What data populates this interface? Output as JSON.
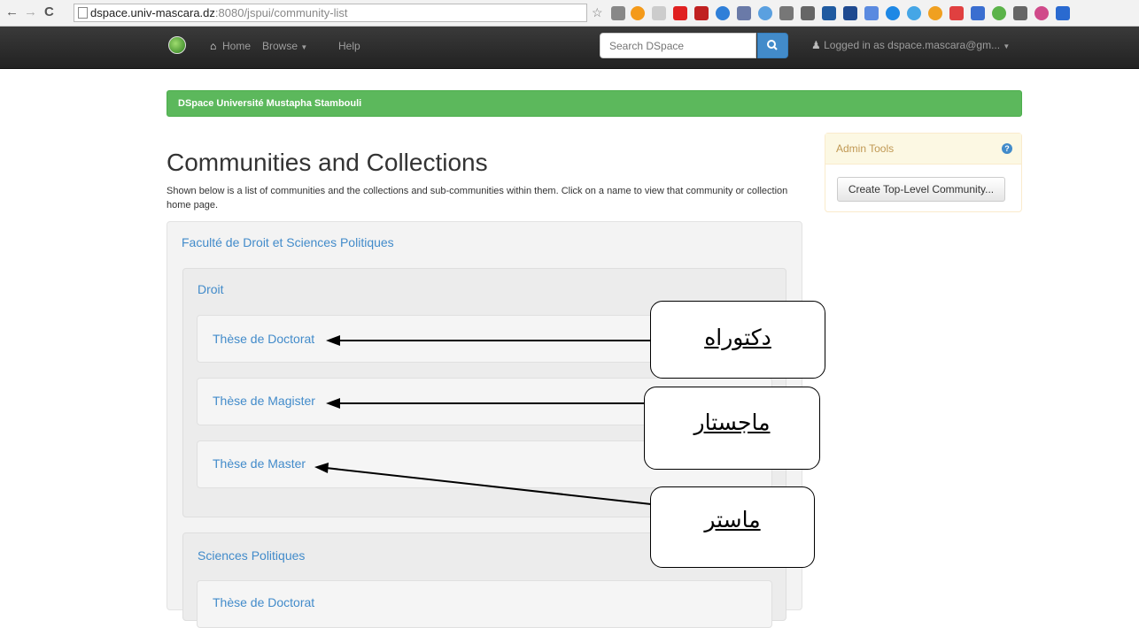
{
  "browser": {
    "url_host": "dspace.univ-mascara.dz",
    "url_rest": ":8080/jspui/community-list"
  },
  "navbar": {
    "home_label": "Home",
    "browse_label": "Browse",
    "help_label": "Help",
    "search_placeholder": "Search DSpace",
    "user_label": "Logged in as dspace.mascara@gm..."
  },
  "banner": {
    "title": "DSpace Université Mustapha Stambouli"
  },
  "page": {
    "title": "Communities and Collections",
    "intro": "Shown below is a list of communities and the collections and sub-communities within them. Click on a name to view that community or collection home page."
  },
  "admin_tools": {
    "heading": "Admin Tools",
    "help_glyph": "?",
    "create_button": "Create Top-Level Community..."
  },
  "communities": [
    {
      "name": "Faculté de Droit et Sciences Politiques",
      "sub": [
        {
          "name": "Droit",
          "collections": [
            "Thèse de Doctorat",
            "Thèse de Magister",
            "Thèse de Master"
          ]
        },
        {
          "name": "Sciences Politiques",
          "collections": [
            "Thèse de Doctorat"
          ]
        }
      ]
    }
  ],
  "callouts": [
    "دكتوراه",
    "ماجستار",
    "ماستر"
  ]
}
